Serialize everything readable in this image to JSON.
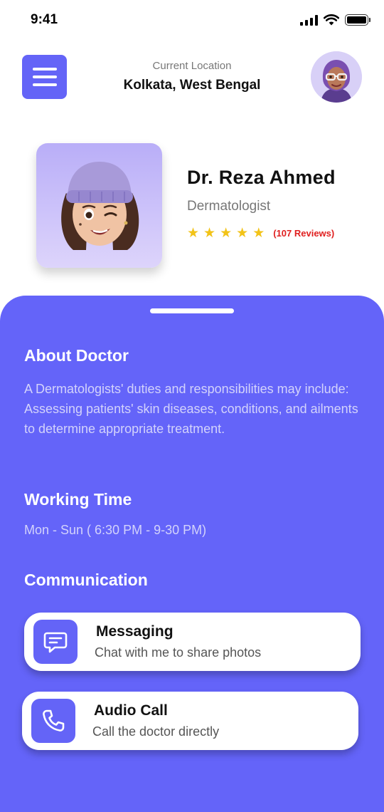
{
  "status_bar": {
    "time": "9:41",
    "battery_level": 1.0
  },
  "header": {
    "menu_icon": "hamburger-menu-icon",
    "location_label": "Current Location",
    "location_value": "Kolkata, West Bengal",
    "avatar_icon": "user-avatar-icon"
  },
  "doctor": {
    "name": "Dr. Reza Ahmed",
    "specialty": "Dermatologist",
    "rating_stars": 5,
    "reviews": "(107 Reviews)"
  },
  "details": {
    "about_title": "About Doctor",
    "about_text": "A Dermatologists' duties and responsibilities may include: Assessing patients' skin diseases, conditions, and ailments to determine appropriate treatment.",
    "working_title": "Working Time",
    "working_text": "Mon - Sun ( 6:30 PM - 9-30 PM)",
    "communication_title": "Communication",
    "communication": [
      {
        "title": "Messaging",
        "subtitle": "Chat with me to share photos",
        "icon": "chat-bubble-icon"
      },
      {
        "title": "Audio Call",
        "subtitle": "Call the doctor directly",
        "icon": "phone-icon"
      }
    ]
  },
  "colors": {
    "accent": "#6464f7",
    "panel": "#6464f9",
    "star": "#f2c318",
    "reviews": "#e02020"
  }
}
